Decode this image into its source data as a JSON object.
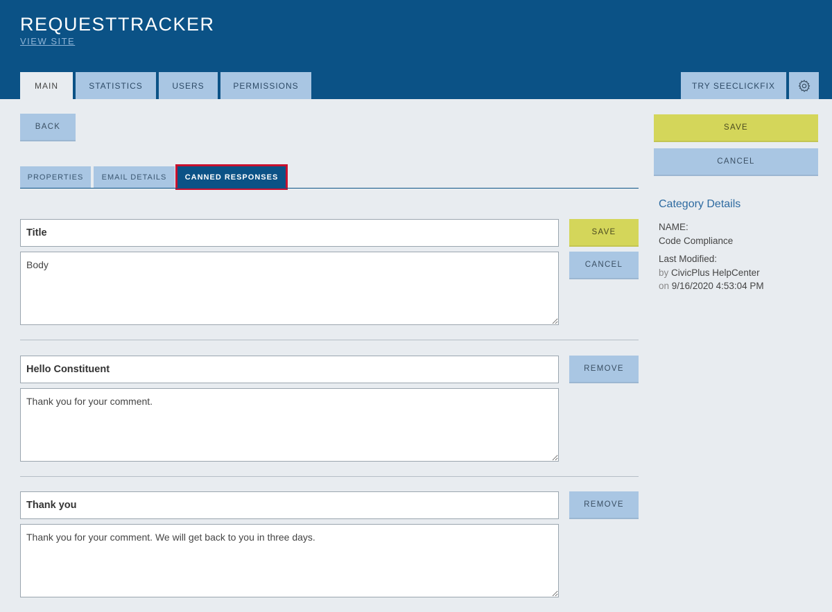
{
  "header": {
    "app_title": "REQUESTTRACKER",
    "view_site": "VIEW SITE",
    "tabs": [
      {
        "label": "MAIN",
        "active": true
      },
      {
        "label": "STATISTICS",
        "active": false
      },
      {
        "label": "USERS",
        "active": false
      },
      {
        "label": "PERMISSIONS",
        "active": false
      }
    ],
    "try_button": "TRY SEECLICKFIX",
    "settings_icon": "gear-icon"
  },
  "toolbar": {
    "back_label": "BACK"
  },
  "sub_tabs": [
    {
      "label": "PROPERTIES",
      "active": false
    },
    {
      "label": "EMAIL DETAILS",
      "active": false
    },
    {
      "label": "CANNED RESPONSES",
      "active": true
    }
  ],
  "new_response": {
    "title_placeholder": "Title",
    "body_placeholder": "Body",
    "save_label": "SAVE",
    "cancel_label": "CANCEL"
  },
  "responses": [
    {
      "title": "Hello Constituent",
      "body": "Thank you for your comment.",
      "remove_label": "REMOVE"
    },
    {
      "title": "Thank you",
      "body": "Thank you for your comment. We will get back to you in three days.",
      "remove_label": "REMOVE"
    }
  ],
  "sidebar": {
    "save_label": "SAVE",
    "cancel_label": "CANCEL",
    "heading": "Category Details",
    "name_label": "NAME:",
    "name_value": "Code Compliance",
    "modified_label": "Last Modified:",
    "by_prefix": "by",
    "by_value": "CivicPlus HelpCenter",
    "on_prefix": "on",
    "on_value": "9/16/2020 4:53:04 PM"
  },
  "colors": {
    "header_bg": "#0b5286",
    "tab_bg": "#a9c6e3",
    "save_bg": "#d4d65a",
    "active_outline": "#c8102e",
    "page_bg": "#e8ecf0"
  }
}
